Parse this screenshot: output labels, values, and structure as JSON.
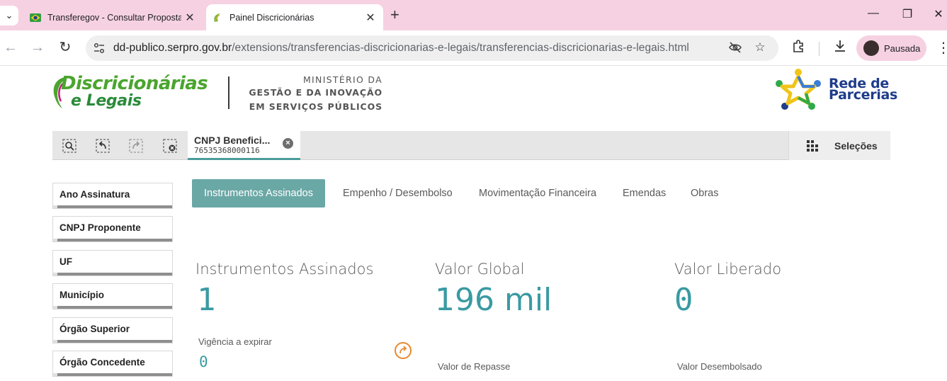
{
  "browser": {
    "tabs": [
      {
        "title": "Transferegov - Consultar Proposta",
        "active": false
      },
      {
        "title": "Painel Discricionárias",
        "active": true
      }
    ],
    "url_host": "dd-publico.serpro.gov.br",
    "url_path": "/extensions/transferencias-discricionarias-e-legais/transferencias-discricionarias-e-legais.html",
    "profile_label": "Pausada"
  },
  "header": {
    "logo_line1": "Discricionárias",
    "logo_line2": "e Legais",
    "ministry_line1": "MINISTÉRIO DA",
    "ministry_line2": "GESTÃO E DA INOVAÇÃO",
    "ministry_line3": "EM SERVIÇOS PÚBLICOS",
    "partner_line1": "Rede de",
    "partner_line2": "Parcerias"
  },
  "selection_bar": {
    "chip_title": "CNPJ Benefici...",
    "chip_value": "76535368000116",
    "selections_label": "Seleções"
  },
  "filters": [
    "Ano Assinatura",
    "CNPJ Proponente",
    "UF",
    "Município",
    "Órgão Superior",
    "Órgão Concedente"
  ],
  "tabs": [
    "Instrumentos Assinados",
    "Empenho / Desembolso",
    "Movimentação Financeira",
    "Emendas",
    "Obras"
  ],
  "active_tab_index": 0,
  "kpis": [
    {
      "title": "Instrumentos Assinados",
      "value": "1",
      "sub_title": "Vigência a expirar",
      "sub_value": "0"
    },
    {
      "title": "Valor Global",
      "value": "196 mil",
      "sub_title": "Valor de Repasse"
    },
    {
      "title": "Valor Liberado",
      "value": "0",
      "sub_title": "Valor Desembolsado"
    }
  ],
  "colors": {
    "accent": "#6aa8a6",
    "kpi_value": "#3a9aa2",
    "tabbar": "#f6d1e2"
  }
}
